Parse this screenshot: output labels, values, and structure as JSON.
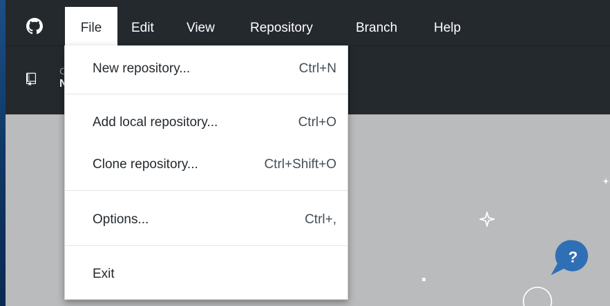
{
  "menubar": {
    "items": [
      {
        "label": "File",
        "active": true
      },
      {
        "label": "Edit"
      },
      {
        "label": "View"
      },
      {
        "label": "Repository"
      },
      {
        "label": "Branch"
      },
      {
        "label": "Help"
      }
    ]
  },
  "file_menu": {
    "items": [
      {
        "label": "New repository...",
        "shortcut": "Ctrl+N"
      },
      {
        "label": "Add local repository...",
        "shortcut": "Ctrl+O"
      },
      {
        "label": "Clone repository...",
        "shortcut": "Ctrl+Shift+O"
      },
      {
        "label": "Options...",
        "shortcut": "Ctrl+,"
      },
      {
        "label": "Exit",
        "shortcut": ""
      }
    ]
  },
  "repo_selector": {
    "caption_fragment": "C",
    "name_fragment": "N"
  },
  "colors": {
    "titlebar": "#24292e",
    "content_bg": "#babbbc",
    "menu_bg": "#ffffff",
    "accent_blue": "#2f6fb5"
  },
  "icons": {
    "app_logo": "github-logo-icon",
    "repo": "repository-icon",
    "decoration": "help-bubble-icon"
  }
}
